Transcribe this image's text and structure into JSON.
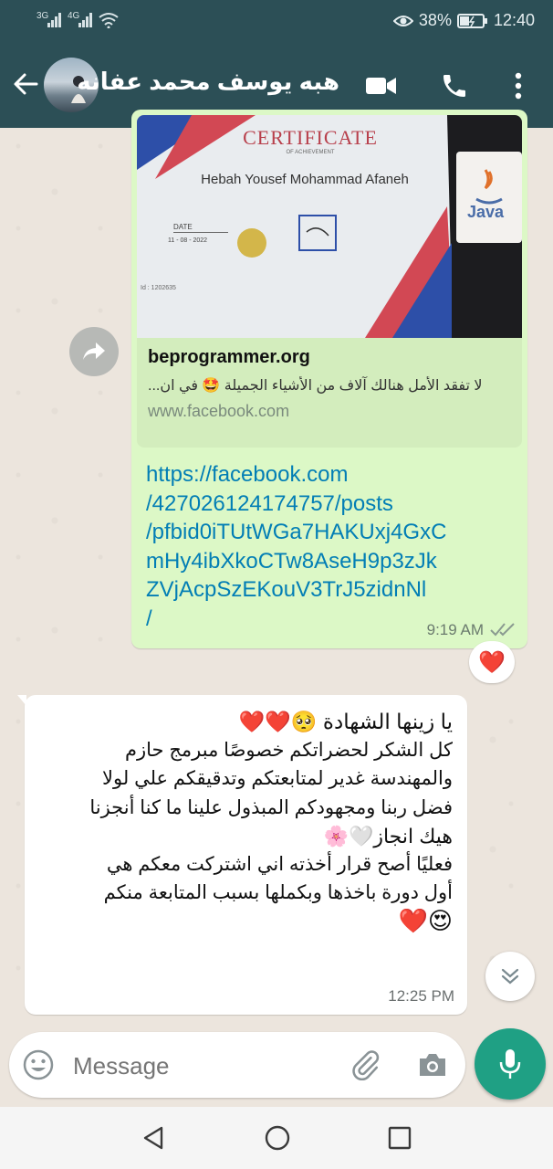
{
  "status": {
    "signal_1": "3G",
    "signal_2": "4G",
    "battery": "38%",
    "time": "12:40"
  },
  "header": {
    "contact_name": "هبه يوسف محمد عفانه"
  },
  "link_preview": {
    "certificate_title": "CERTIFICATE",
    "certificate_sub": "OF ACHIEVEMENT",
    "certificate_name": "Hebah Yousef Mohammad Afaneh",
    "certificate_date_label": "DATE",
    "certificate_date": "11 - 08 - 2022",
    "certificate_id": "Id : 1202635",
    "java_text": "Java",
    "site_title": "beprogrammer.org",
    "description": "لا تفقد الأمل هنالك آلاف من الأشياء الجميلة 🤩 في ان...",
    "domain": "www.facebook.com"
  },
  "outgoing": {
    "url_lines": [
      "https://facebook.com",
      "/427026124174757/posts",
      "/pfbid0iTUtWGa7HAKUxj4GxC",
      "mHy4ibXkoCTw8AseH9p3zJk",
      "ZVjAcpSzEKouV3TrJ5zidnNl",
      "/"
    ],
    "time": "9:19 AM",
    "reaction": "❤️"
  },
  "incoming": {
    "lines": [
      "يا زينها الشهادة 🥺❤️❤️",
      "كل الشكر لحضراتكم خصوصًا مبرمج حازم",
      "والمهندسة غدير لمتابعتكم وتدقيقكم علي لولا",
      "فضل ربنا ومجهودكم المبذول علينا ما كنا أنجزنا",
      "هيك انجاز🤍🌸",
      "فعليًا أصح قرار أخذته اني اشتركت معكم هي",
      "أول دورة باخذها وبكملها  بسبب المتابعة منكم",
      "😍❤️"
    ],
    "time": "12:25 PM"
  },
  "composer": {
    "placeholder": "Message"
  },
  "colors": {
    "header": "#2c4f56",
    "outgoing_bubble": "#dcf8c6",
    "link": "#027eb5",
    "accent": "#1fa084"
  }
}
